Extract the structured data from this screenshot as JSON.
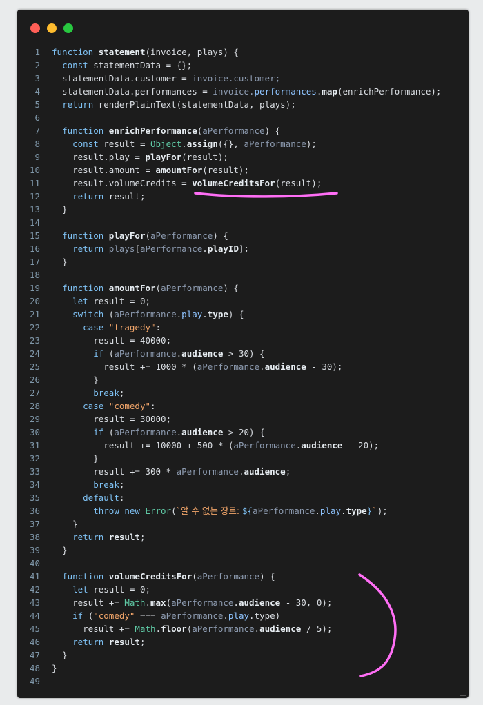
{
  "window": {
    "controls": [
      {
        "name": "close",
        "color": "#ff5f57"
      },
      {
        "name": "minimize",
        "color": "#febc2e"
      },
      {
        "name": "maximize",
        "color": "#28c840"
      }
    ]
  },
  "code": {
    "lines": [
      {
        "n": "1",
        "tokens": [
          [
            "keyword",
            "function "
          ],
          [
            "function",
            "statement"
          ],
          [
            "plain",
            "(invoice, plays) {"
          ]
        ]
      },
      {
        "n": "2",
        "tokens": [
          [
            "plain",
            "  "
          ],
          [
            "keyword",
            "const "
          ],
          [
            "plain",
            "statementData = {};"
          ]
        ]
      },
      {
        "n": "3",
        "tokens": [
          [
            "plain",
            "  statementData.customer = "
          ],
          [
            "param",
            "invoice.customer;"
          ]
        ]
      },
      {
        "n": "4",
        "tokens": [
          [
            "plain",
            "  statementData.performances = "
          ],
          [
            "param",
            "invoice."
          ],
          [
            "property",
            "performances"
          ],
          [
            "plain",
            "."
          ],
          [
            "function",
            "map"
          ],
          [
            "plain",
            "(enrichPerformance);"
          ]
        ]
      },
      {
        "n": "5",
        "tokens": [
          [
            "plain",
            "  "
          ],
          [
            "keyword",
            "return "
          ],
          [
            "plain",
            "renderPlainText(statementData, plays);"
          ]
        ]
      },
      {
        "n": "6",
        "tokens": []
      },
      {
        "n": "7",
        "tokens": [
          [
            "plain",
            "  "
          ],
          [
            "keyword",
            "function "
          ],
          [
            "function",
            "enrichPerformance"
          ],
          [
            "plain",
            "("
          ],
          [
            "param",
            "aPerformance"
          ],
          [
            "plain",
            ") {"
          ]
        ]
      },
      {
        "n": "8",
        "tokens": [
          [
            "plain",
            "    "
          ],
          [
            "keyword",
            "const "
          ],
          [
            "plain",
            "result = "
          ],
          [
            "builtin",
            "Object"
          ],
          [
            "plain",
            "."
          ],
          [
            "function",
            "assign"
          ],
          [
            "plain",
            "({}, "
          ],
          [
            "param",
            "aPerformance"
          ],
          [
            "plain",
            ");"
          ]
        ]
      },
      {
        "n": "9",
        "tokens": [
          [
            "plain",
            "    result.play = "
          ],
          [
            "function",
            "playFor"
          ],
          [
            "plain",
            "(result);"
          ]
        ]
      },
      {
        "n": "10",
        "tokens": [
          [
            "plain",
            "    result.amount = "
          ],
          [
            "function",
            "amountFor"
          ],
          [
            "plain",
            "(result);"
          ]
        ]
      },
      {
        "n": "11",
        "tokens": [
          [
            "plain",
            "    result.volumeCredits = "
          ],
          [
            "function",
            "volumeCreditsFor"
          ],
          [
            "plain",
            "(result);"
          ]
        ]
      },
      {
        "n": "12",
        "tokens": [
          [
            "plain",
            "    "
          ],
          [
            "keyword",
            "return "
          ],
          [
            "plain",
            "result;"
          ]
        ]
      },
      {
        "n": "13",
        "tokens": [
          [
            "plain",
            "  }"
          ]
        ]
      },
      {
        "n": "14",
        "tokens": []
      },
      {
        "n": "15",
        "tokens": [
          [
            "plain",
            "  "
          ],
          [
            "keyword",
            "function "
          ],
          [
            "function",
            "playFor"
          ],
          [
            "plain",
            "("
          ],
          [
            "param",
            "aPerformance"
          ],
          [
            "plain",
            ") {"
          ]
        ]
      },
      {
        "n": "16",
        "tokens": [
          [
            "plain",
            "    "
          ],
          [
            "keyword",
            "return "
          ],
          [
            "param",
            "plays"
          ],
          [
            "plain",
            "["
          ],
          [
            "param",
            "aPerformance"
          ],
          [
            "plain",
            "."
          ],
          [
            "function",
            "playID"
          ],
          [
            "plain",
            "];"
          ]
        ]
      },
      {
        "n": "17",
        "tokens": [
          [
            "plain",
            "  }"
          ]
        ]
      },
      {
        "n": "18",
        "tokens": []
      },
      {
        "n": "19",
        "tokens": [
          [
            "plain",
            "  "
          ],
          [
            "keyword",
            "function "
          ],
          [
            "function",
            "amountFor"
          ],
          [
            "plain",
            "("
          ],
          [
            "param",
            "aPerformance"
          ],
          [
            "plain",
            ") {"
          ]
        ]
      },
      {
        "n": "20",
        "tokens": [
          [
            "plain",
            "    "
          ],
          [
            "keyword",
            "let "
          ],
          [
            "plain",
            "result = 0;"
          ]
        ]
      },
      {
        "n": "21",
        "tokens": [
          [
            "plain",
            "    "
          ],
          [
            "keyword",
            "switch "
          ],
          [
            "plain",
            "("
          ],
          [
            "param",
            "aPerformance"
          ],
          [
            "plain",
            "."
          ],
          [
            "property",
            "play"
          ],
          [
            "plain",
            "."
          ],
          [
            "function",
            "type"
          ],
          [
            "plain",
            ") {"
          ]
        ]
      },
      {
        "n": "22",
        "tokens": [
          [
            "plain",
            "      "
          ],
          [
            "keyword",
            "case "
          ],
          [
            "string",
            "\"tragedy\""
          ],
          [
            "plain",
            ":"
          ]
        ]
      },
      {
        "n": "23",
        "tokens": [
          [
            "plain",
            "        result = 40000;"
          ]
        ]
      },
      {
        "n": "24",
        "tokens": [
          [
            "plain",
            "        "
          ],
          [
            "keyword",
            "if "
          ],
          [
            "plain",
            "("
          ],
          [
            "param",
            "aPerformance"
          ],
          [
            "plain",
            "."
          ],
          [
            "function",
            "audience"
          ],
          [
            "plain",
            " > 30) {"
          ]
        ]
      },
      {
        "n": "25",
        "tokens": [
          [
            "plain",
            "          result += 1000 * ("
          ],
          [
            "param",
            "aPerformance"
          ],
          [
            "plain",
            "."
          ],
          [
            "function",
            "audience"
          ],
          [
            "plain",
            " - 30);"
          ]
        ]
      },
      {
        "n": "26",
        "tokens": [
          [
            "plain",
            "        }"
          ]
        ]
      },
      {
        "n": "27",
        "tokens": [
          [
            "plain",
            "        "
          ],
          [
            "keyword",
            "break"
          ],
          [
            "plain",
            ";"
          ]
        ]
      },
      {
        "n": "28",
        "tokens": [
          [
            "plain",
            "      "
          ],
          [
            "keyword",
            "case "
          ],
          [
            "string",
            "\"comedy\""
          ],
          [
            "plain",
            ":"
          ]
        ]
      },
      {
        "n": "29",
        "tokens": [
          [
            "plain",
            "        result = 30000;"
          ]
        ]
      },
      {
        "n": "30",
        "tokens": [
          [
            "plain",
            "        "
          ],
          [
            "keyword",
            "if "
          ],
          [
            "plain",
            "("
          ],
          [
            "param",
            "aPerformance"
          ],
          [
            "plain",
            "."
          ],
          [
            "function",
            "audience"
          ],
          [
            "plain",
            " > 20) {"
          ]
        ]
      },
      {
        "n": "31",
        "tokens": [
          [
            "plain",
            "          result += 10000 + 500 * ("
          ],
          [
            "param",
            "aPerformance"
          ],
          [
            "plain",
            "."
          ],
          [
            "function",
            "audience"
          ],
          [
            "plain",
            " - 20);"
          ]
        ]
      },
      {
        "n": "32",
        "tokens": [
          [
            "plain",
            "        }"
          ]
        ]
      },
      {
        "n": "33",
        "tokens": [
          [
            "plain",
            "        result += 300 * "
          ],
          [
            "param",
            "aPerformance"
          ],
          [
            "plain",
            "."
          ],
          [
            "function",
            "audience"
          ],
          [
            "plain",
            ";"
          ]
        ]
      },
      {
        "n": "34",
        "tokens": [
          [
            "plain",
            "        "
          ],
          [
            "keyword",
            "break"
          ],
          [
            "plain",
            ";"
          ]
        ]
      },
      {
        "n": "35",
        "tokens": [
          [
            "plain",
            "      "
          ],
          [
            "keyword",
            "default"
          ],
          [
            "plain",
            ":"
          ]
        ]
      },
      {
        "n": "36",
        "tokens": [
          [
            "plain",
            "        "
          ],
          [
            "keyword",
            "throw new "
          ],
          [
            "builtin",
            "Error"
          ],
          [
            "plain",
            "("
          ],
          [
            "string",
            "`알 수 없는 장르: "
          ],
          [
            "keyword",
            "${"
          ],
          [
            "param",
            "aPerformance"
          ],
          [
            "plain",
            "."
          ],
          [
            "property",
            "play"
          ],
          [
            "plain",
            "."
          ],
          [
            "function",
            "type"
          ],
          [
            "keyword",
            "}"
          ],
          [
            "string",
            "`"
          ],
          [
            "plain",
            ");"
          ]
        ]
      },
      {
        "n": "37",
        "tokens": [
          [
            "plain",
            "    }"
          ]
        ]
      },
      {
        "n": "38",
        "tokens": [
          [
            "plain",
            "    "
          ],
          [
            "keyword",
            "return "
          ],
          [
            "function",
            "result"
          ],
          [
            "plain",
            ";"
          ]
        ]
      },
      {
        "n": "39",
        "tokens": [
          [
            "plain",
            "  }"
          ]
        ]
      },
      {
        "n": "40",
        "tokens": []
      },
      {
        "n": "41",
        "tokens": [
          [
            "plain",
            "  "
          ],
          [
            "keyword",
            "function "
          ],
          [
            "function",
            "volumeCreditsFor"
          ],
          [
            "plain",
            "("
          ],
          [
            "param",
            "aPerformance"
          ],
          [
            "plain",
            ") {"
          ]
        ]
      },
      {
        "n": "42",
        "tokens": [
          [
            "plain",
            "    "
          ],
          [
            "keyword",
            "let "
          ],
          [
            "plain",
            "result = 0;"
          ]
        ]
      },
      {
        "n": "43",
        "tokens": [
          [
            "plain",
            "    result += "
          ],
          [
            "builtin",
            "Math"
          ],
          [
            "plain",
            "."
          ],
          [
            "function",
            "max"
          ],
          [
            "plain",
            "("
          ],
          [
            "param",
            "aPerformance"
          ],
          [
            "plain",
            "."
          ],
          [
            "function",
            "audience"
          ],
          [
            "plain",
            " - 30, 0);"
          ]
        ]
      },
      {
        "n": "44",
        "tokens": [
          [
            "plain",
            "    "
          ],
          [
            "keyword",
            "if "
          ],
          [
            "plain",
            "("
          ],
          [
            "string",
            "\"comedy\""
          ],
          [
            "plain",
            " === "
          ],
          [
            "param",
            "aPerformance"
          ],
          [
            "plain",
            "."
          ],
          [
            "property",
            "play"
          ],
          [
            "plain",
            ".type)"
          ]
        ]
      },
      {
        "n": "45",
        "tokens": [
          [
            "plain",
            "      result += "
          ],
          [
            "builtin",
            "Math"
          ],
          [
            "plain",
            "."
          ],
          [
            "function",
            "floor"
          ],
          [
            "plain",
            "("
          ],
          [
            "param",
            "aPerformance"
          ],
          [
            "plain",
            "."
          ],
          [
            "function",
            "audience"
          ],
          [
            "plain",
            " / 5);"
          ]
        ]
      },
      {
        "n": "46",
        "tokens": [
          [
            "plain",
            "    "
          ],
          [
            "keyword",
            "return "
          ],
          [
            "function",
            "result"
          ],
          [
            "plain",
            ";"
          ]
        ]
      },
      {
        "n": "47",
        "tokens": [
          [
            "plain",
            "  }"
          ]
        ]
      },
      {
        "n": "48",
        "tokens": [
          [
            "plain",
            "}"
          ]
        ]
      },
      {
        "n": "49",
        "tokens": []
      }
    ]
  },
  "annotations": {
    "stroke_color": "#ff6ef5"
  }
}
